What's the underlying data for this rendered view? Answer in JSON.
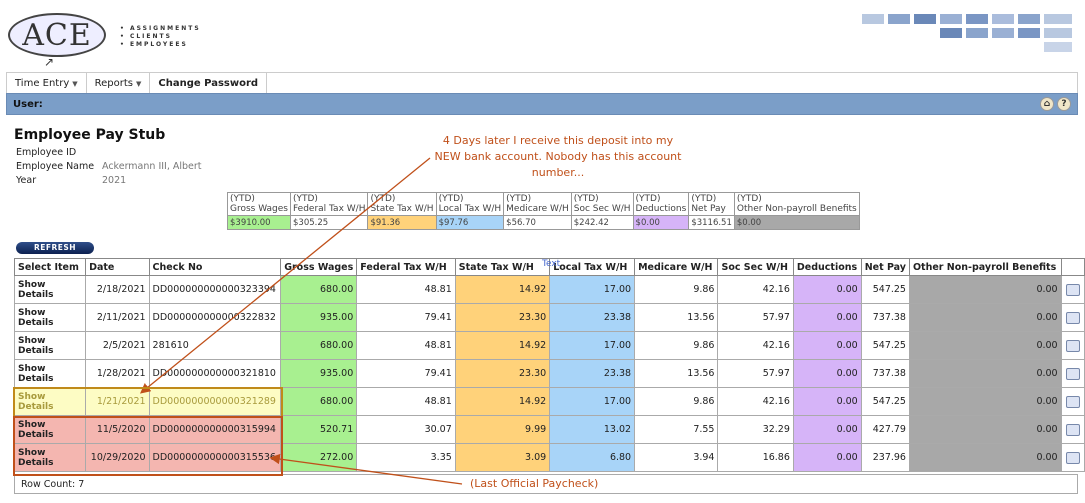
{
  "logo": {
    "text": "ACE",
    "tagline": [
      "ASSIGNMENTS",
      "CLIENTS",
      "EMPLOYEES"
    ]
  },
  "menu": [
    {
      "label": "Time Entry",
      "dropdown": true,
      "bold": false
    },
    {
      "label": "Reports",
      "dropdown": true,
      "bold": false
    },
    {
      "label": "Change Password",
      "dropdown": false,
      "bold": true
    }
  ],
  "userbar": {
    "label": "User:"
  },
  "page": {
    "title": "Employee Pay Stub",
    "fields": [
      {
        "label": "Employee ID",
        "value": ""
      },
      {
        "label": "Employee Name",
        "value": "Ackermann III, Albert"
      },
      {
        "label": "Year",
        "value": "2021"
      }
    ]
  },
  "ytd": {
    "headers": [
      "(YTD)\nGross Wages",
      "(YTD)\nFederal Tax W/H",
      "(YTD)\nState Tax W/H",
      "(YTD)\nLocal Tax W/H",
      "(YTD)\nMedicare W/H",
      "(YTD)\nSoc Sec W/H",
      "(YTD)\nDeductions",
      "(YTD)\nNet Pay",
      "(YTD)\nOther Non-payroll Benefits"
    ],
    "values": [
      "$3910.00",
      "$305.25",
      "$91.36",
      "$97.76",
      "$56.70",
      "$242.42",
      "$0.00",
      "$3116.51",
      "$0.00"
    ]
  },
  "refresh_label": "REFRESH",
  "table": {
    "headers": [
      "Select Item",
      "Date",
      "Check No",
      "Gross Wages",
      "Federal Tax W/H",
      "State Tax W/H",
      "Local Tax W/H",
      "Medicare W/H",
      "Soc Sec W/H",
      "Deductions",
      "Net Pay",
      "Other Non-payroll Benefits"
    ],
    "rows": [
      {
        "select": "Show Details",
        "date": "2/18/2021",
        "check": "DD000000000000323394",
        "gross": "680.00",
        "fed": "48.81",
        "state": "14.92",
        "local": "17.00",
        "medicare": "9.86",
        "socsec": "42.16",
        "ded": "0.00",
        "net": "547.25",
        "other": "0.00"
      },
      {
        "select": "Show Details",
        "date": "2/11/2021",
        "check": "DD000000000000322832",
        "gross": "935.00",
        "fed": "79.41",
        "state": "23.30",
        "local": "23.38",
        "medicare": "13.56",
        "socsec": "57.97",
        "ded": "0.00",
        "net": "737.38",
        "other": "0.00"
      },
      {
        "select": "Show Details",
        "date": "2/5/2021",
        "check": "281610",
        "gross": "680.00",
        "fed": "48.81",
        "state": "14.92",
        "local": "17.00",
        "medicare": "9.86",
        "socsec": "42.16",
        "ded": "0.00",
        "net": "547.25",
        "other": "0.00"
      },
      {
        "select": "Show Details",
        "date": "1/28/2021",
        "check": "DD000000000000321810",
        "gross": "935.00",
        "fed": "79.41",
        "state": "23.30",
        "local": "23.38",
        "medicare": "13.56",
        "socsec": "57.97",
        "ded": "0.00",
        "net": "737.38",
        "other": "0.00"
      },
      {
        "select": "Show Details",
        "date": "1/21/2021",
        "check": "DD000000000000321289",
        "gross": "680.00",
        "fed": "48.81",
        "state": "14.92",
        "local": "17.00",
        "medicare": "9.86",
        "socsec": "42.16",
        "ded": "0.00",
        "net": "547.25",
        "other": "0.00"
      },
      {
        "select": "Show Details",
        "date": "11/5/2020",
        "check": "DD000000000000315994",
        "gross": "520.71",
        "fed": "30.07",
        "state": "9.99",
        "local": "13.02",
        "medicare": "7.55",
        "socsec": "32.29",
        "ded": "0.00",
        "net": "427.79",
        "other": "0.00"
      },
      {
        "select": "Show Details",
        "date": "10/29/2020",
        "check": "DD000000000000315536",
        "gross": "272.00",
        "fed": "3.35",
        "state": "3.09",
        "local": "6.80",
        "medicare": "3.94",
        "socsec": "16.86",
        "ded": "0.00",
        "net": "237.96",
        "other": "0.00"
      }
    ],
    "row_count": "Row Count: 7"
  },
  "annotations": {
    "top": "4 Days later I receive this deposit into my NEW bank account. Nobody has this account number...",
    "bottom": "(Last Official Paycheck)",
    "tooltip": "Text"
  },
  "colors": {
    "gross": "#a8f090",
    "state": "#ffd27a",
    "local": "#a8d4f8",
    "deductions": "#d6b4f8",
    "other": "#a8a8a8",
    "annotation": "#c0501a",
    "userbar": "#7b9ec8"
  }
}
